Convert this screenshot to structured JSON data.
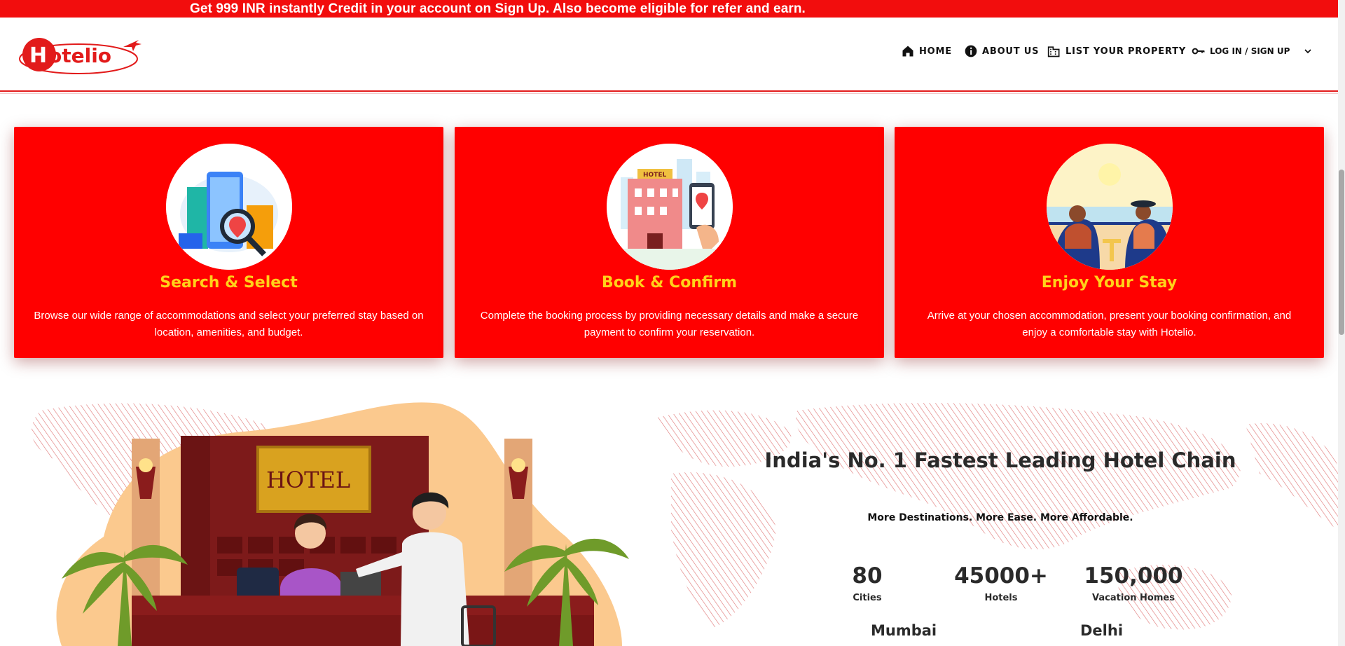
{
  "promo": {
    "text": "Get 999 INR instantly Credit in your account on Sign Up. Also become eligible for refer and earn."
  },
  "brand": {
    "logo_text": "Hotelio",
    "color": "#e21b1b"
  },
  "nav": {
    "home": "HOME",
    "about": "ABOUT US",
    "list_property": "LIST YOUR PROPERTY",
    "login": "LOG IN / SIGN UP"
  },
  "steps": [
    {
      "title": "Search & Select",
      "text": "Browse our wide range of accommodations and select your preferred stay based on location, amenities, and budget.",
      "icon": "search-map-illustration"
    },
    {
      "title": "Book & Confirm",
      "text": "Complete the booking process by providing necessary details and make a secure payment to confirm your reservation.",
      "icon": "hotel-booking-illustration"
    },
    {
      "title": "Enjoy Your Stay",
      "text": "Arrive at your chosen accommodation, present your booking confirmation, and enjoy a comfortable stay with Hotelio.",
      "icon": "couple-balcony-illustration"
    }
  ],
  "illustration": {
    "sign": "HOTEL"
  },
  "stats": {
    "title": "India's No. 1 Fastest Leading Hotel Chain",
    "subtitle": "More Destinations. More Ease. More Affordable.",
    "items": [
      {
        "value": "80",
        "label": "Cities"
      },
      {
        "value": "45000+",
        "label": "Hotels"
      },
      {
        "value": "150,000",
        "label": "Vacation Homes"
      }
    ],
    "cities": [
      "Mumbai",
      "Delhi"
    ]
  },
  "colors": {
    "accent": "#ff0000",
    "heading_yellow": "#ffd21a",
    "text_dark": "#2a2a2a"
  }
}
